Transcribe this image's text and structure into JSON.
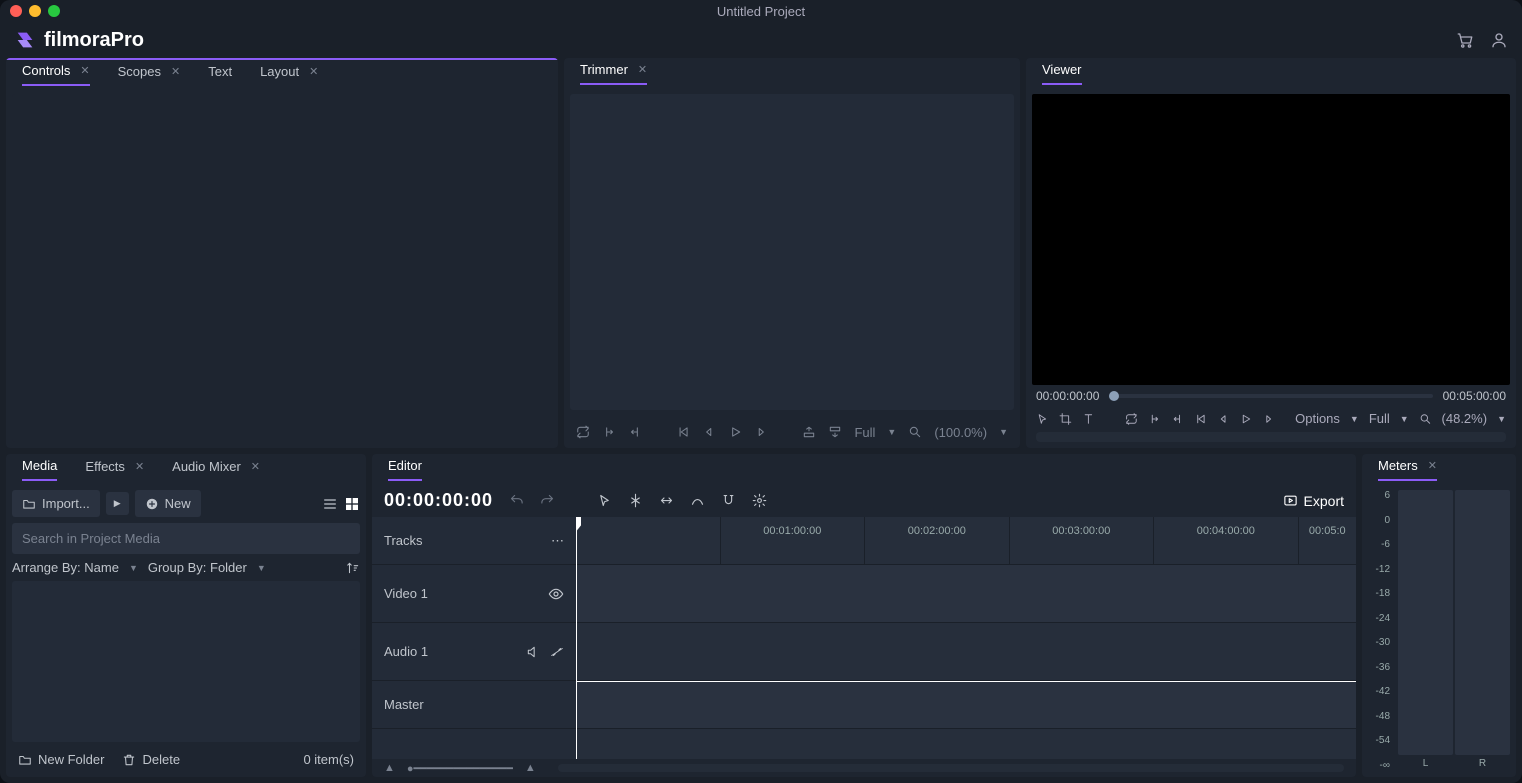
{
  "window": {
    "title": "Untitled Project"
  },
  "brand": {
    "name": "filmoraPro"
  },
  "colors": {
    "accent": "#8b5cf6",
    "traffic_red": "#ff5f57",
    "traffic_yellow": "#febc2e",
    "traffic_green": "#28c840"
  },
  "topPanels": {
    "controls": {
      "tabs": [
        {
          "label": "Controls",
          "closable": true,
          "active": true
        },
        {
          "label": "Scopes",
          "closable": true,
          "active": false
        },
        {
          "label": "Text",
          "closable": false,
          "active": false
        },
        {
          "label": "Layout",
          "closable": true,
          "active": false
        }
      ]
    },
    "trimmer": {
      "tab": "Trimmer",
      "quality": "Full",
      "zoom": "(100.0%)"
    },
    "viewer": {
      "tab": "Viewer",
      "time_start": "00:00:00:00",
      "time_end": "00:05:00:00",
      "options": "Options",
      "quality": "Full",
      "zoom": "(48.2%)"
    }
  },
  "media": {
    "tabs": [
      {
        "label": "Media",
        "closable": false,
        "active": true
      },
      {
        "label": "Effects",
        "closable": true,
        "active": false
      },
      {
        "label": "Audio Mixer",
        "closable": true,
        "active": false
      }
    ],
    "import": "Import...",
    "new": "New",
    "search_placeholder": "Search in Project Media",
    "arrange": "Arrange By: Name",
    "group": "Group By: Folder",
    "new_folder": "New Folder",
    "delete": "Delete",
    "count": "0 item(s)"
  },
  "editor": {
    "tab": "Editor",
    "timecode": "00:00:00:00",
    "export": "Export",
    "tracks_label": "Tracks",
    "tracks": [
      {
        "name": "Video 1"
      },
      {
        "name": "Audio 1"
      },
      {
        "name": "Master"
      }
    ],
    "ruler": [
      "00:01:00:00",
      "00:02:00:00",
      "00:03:00:00",
      "00:04:00:00",
      "00:05:0"
    ]
  },
  "meters": {
    "tab": "Meters",
    "scale": [
      "6",
      "0",
      "-6",
      "-12",
      "-18",
      "-24",
      "-30",
      "-36",
      "-42",
      "-48",
      "-54",
      "-∞"
    ],
    "channels": [
      "L",
      "R"
    ]
  }
}
